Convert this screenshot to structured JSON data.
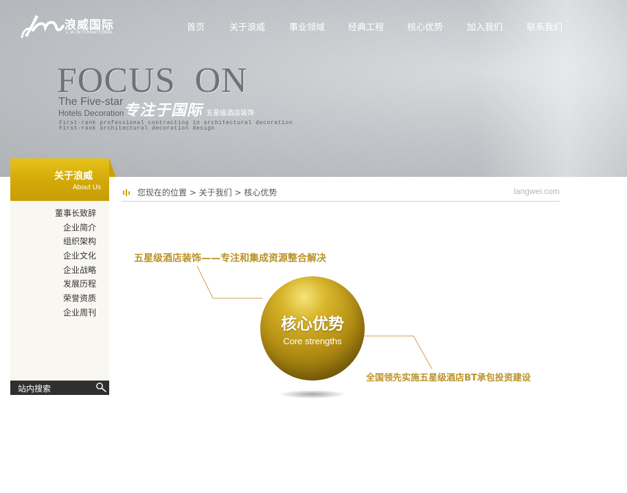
{
  "logo": {
    "cn": "浪威国际",
    "en": "L.W.INTERNATIONAL"
  },
  "nav": {
    "items": [
      "首页",
      "关于浪威",
      "事业领域",
      "经典工程",
      "核心优势",
      "加入我们",
      "联系我们"
    ]
  },
  "banner": {
    "title": "FOCUS  ON",
    "en_line1": "The Five-star",
    "en_line2": "Hotels Decoration",
    "cn_title": "专注于国际",
    "cn_sub": "五星级酒店装饰",
    "desc1": "First-rank professional contracting in architectural decoration",
    "desc2": "First-rank architectural decoration design"
  },
  "sidebar": {
    "title_cn": "关于浪威",
    "title_en": "About Us",
    "items": [
      "董事长致辞",
      "企业简介",
      "组织架构",
      "企业文化",
      "企业战略",
      "发展历程",
      "荣誉资质",
      "企业周刊"
    ],
    "search_label": "站内搜索"
  },
  "breadcrumb": {
    "text": "您现在的位置 > 关于我们 > 核心优势",
    "site": "langwei.com"
  },
  "diagram": {
    "top_text": "五星级酒店装饰——专注和集成资源整合解决",
    "orb_cn": "核心优势",
    "orb_en": "Core strengths",
    "bottom_text": "全国领先实施五星级酒店BT承包投资建设"
  },
  "colors": {
    "accent_gold": "#d2a808",
    "text_gold": "#bb9226",
    "search_bg": "#2f2f2f"
  }
}
